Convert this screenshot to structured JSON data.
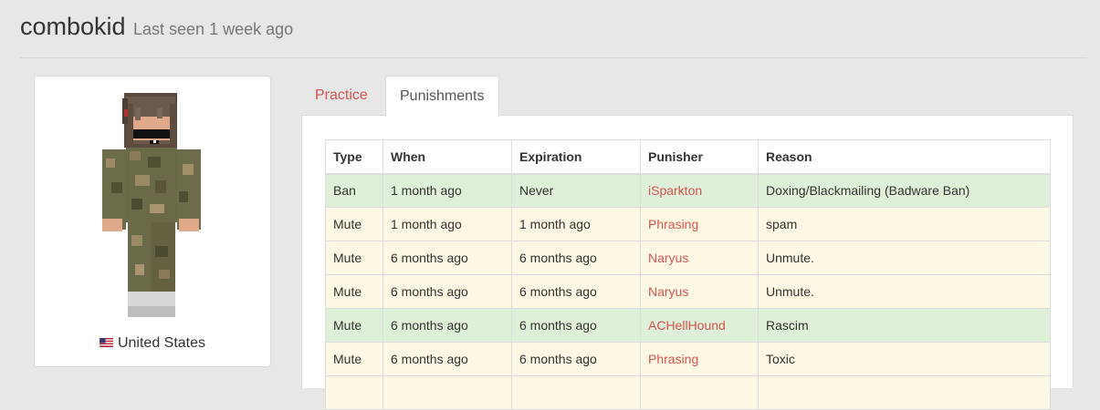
{
  "profile": {
    "username": "combokid",
    "last_seen": "Last seen 1 week ago",
    "country": "United States"
  },
  "tabs": [
    {
      "label": "Practice",
      "active": false
    },
    {
      "label": "Punishments",
      "active": true
    }
  ],
  "table": {
    "headers": [
      "Type",
      "When",
      "Expiration",
      "Punisher",
      "Reason"
    ],
    "rows": [
      {
        "type": "Ban",
        "when": "1 month ago",
        "expiration": "Never",
        "punisher": "iSparkton",
        "reason": "Doxing/Blackmailing (Badware Ban)",
        "status": "success"
      },
      {
        "type": "Mute",
        "when": "1 month ago",
        "expiration": "1 month ago",
        "punisher": "Phrasing",
        "reason": "spam",
        "status": "warning"
      },
      {
        "type": "Mute",
        "when": "6 months ago",
        "expiration": "6 months ago",
        "punisher": "Naryus",
        "reason": "Unmute.",
        "status": "warning"
      },
      {
        "type": "Mute",
        "when": "6 months ago",
        "expiration": "6 months ago",
        "punisher": "Naryus",
        "reason": "Unmute.",
        "status": "warning"
      },
      {
        "type": "Mute",
        "when": "6 months ago",
        "expiration": "6 months ago",
        "punisher": "ACHellHound",
        "reason": "Rascim",
        "status": "success"
      },
      {
        "type": "Mute",
        "when": "6 months ago",
        "expiration": "6 months ago",
        "punisher": "Phrasing",
        "reason": "Toxic",
        "status": "warning"
      },
      {
        "type": "",
        "when": "",
        "expiration": "",
        "punisher": "",
        "reason": "",
        "status": "warning"
      }
    ]
  },
  "colors": {
    "link_red": "#d9534f",
    "success_row": "#dff0d8",
    "warning_row": "#fcf8e3",
    "page_bg": "#e7e7e7"
  }
}
